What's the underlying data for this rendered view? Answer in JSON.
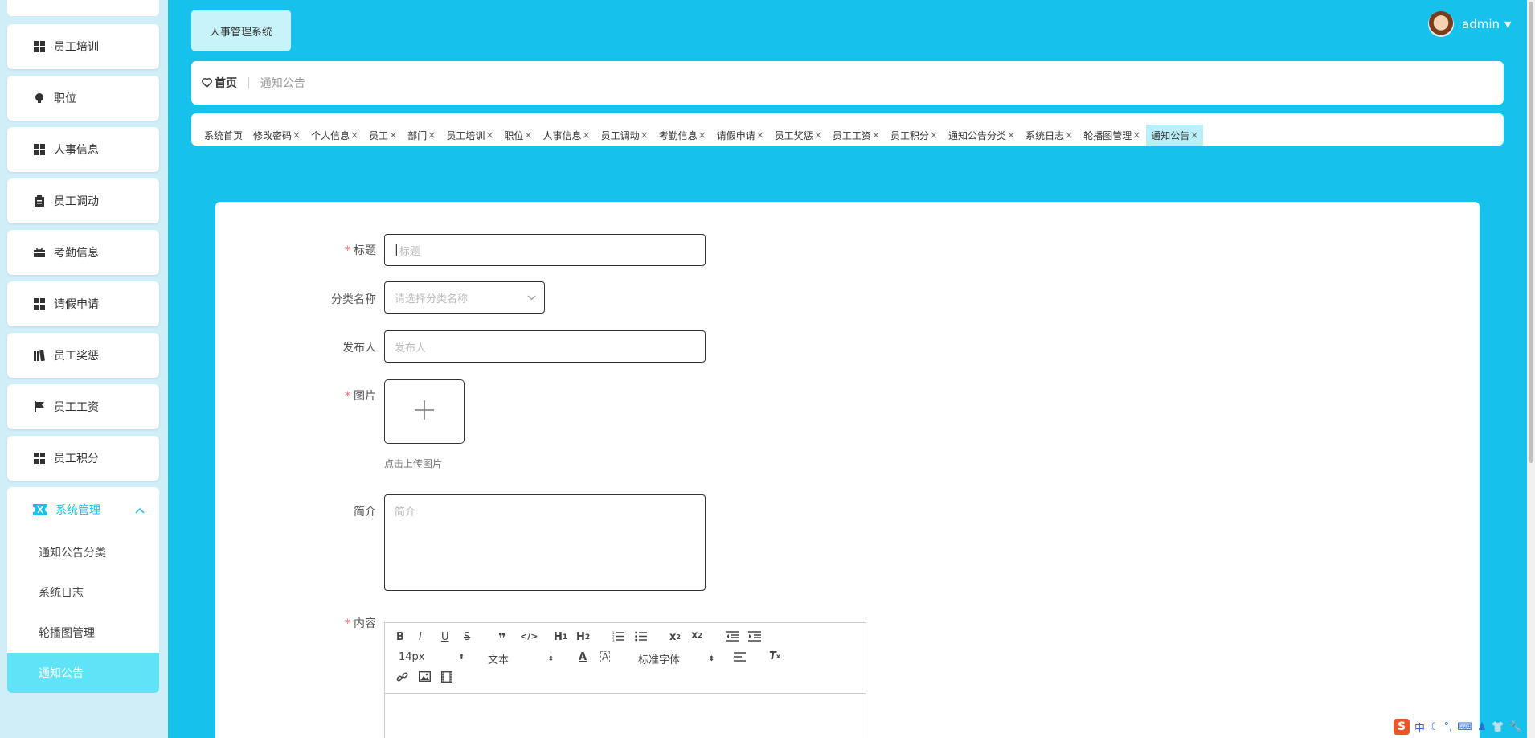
{
  "app": {
    "title": "人事管理系统"
  },
  "user": {
    "name": "admin"
  },
  "sidebar": {
    "items": [
      {
        "label": "员工培训",
        "icon": "grid-icon"
      },
      {
        "label": "职位",
        "icon": "bulb-icon"
      },
      {
        "label": "人事信息",
        "icon": "grid-icon"
      },
      {
        "label": "员工调动",
        "icon": "clipboard-icon"
      },
      {
        "label": "考勤信息",
        "icon": "briefcase-icon"
      },
      {
        "label": "请假申请",
        "icon": "grid-icon"
      },
      {
        "label": "员工奖惩",
        "icon": "book-icon"
      },
      {
        "label": "员工工资",
        "icon": "flag-icon"
      },
      {
        "label": "员工积分",
        "icon": "grid-icon"
      }
    ],
    "group": {
      "label": "系统管理",
      "icon": "ticket-icon",
      "sub": [
        {
          "label": "通知公告分类"
        },
        {
          "label": "系统日志"
        },
        {
          "label": "轮播图管理"
        },
        {
          "label": "通知公告"
        }
      ]
    }
  },
  "breadcrumb": {
    "home": "首页",
    "separator": "|",
    "current": "通知公告"
  },
  "tabs": [
    {
      "label": "系统首页",
      "closable": false
    },
    {
      "label": "修改密码",
      "closable": true
    },
    {
      "label": "个人信息",
      "closable": true
    },
    {
      "label": "员工",
      "closable": true
    },
    {
      "label": "部门",
      "closable": true
    },
    {
      "label": "员工培训",
      "closable": true
    },
    {
      "label": "职位",
      "closable": true
    },
    {
      "label": "人事信息",
      "closable": true
    },
    {
      "label": "员工调动",
      "closable": true
    },
    {
      "label": "考勤信息",
      "closable": true
    },
    {
      "label": "请假申请",
      "closable": true
    },
    {
      "label": "员工奖惩",
      "closable": true
    },
    {
      "label": "员工工资",
      "closable": true
    },
    {
      "label": "员工积分",
      "closable": true
    },
    {
      "label": "通知公告分类",
      "closable": true
    },
    {
      "label": "系统日志",
      "closable": true
    },
    {
      "label": "轮播图管理",
      "closable": true
    },
    {
      "label": "通知公告",
      "closable": true,
      "active": true
    }
  ],
  "form": {
    "title": {
      "label": "标题",
      "placeholder": "标题",
      "required": true
    },
    "category": {
      "label": "分类名称",
      "placeholder": "请选择分类名称"
    },
    "publisher": {
      "label": "发布人",
      "placeholder": "发布人"
    },
    "image": {
      "label": "图片",
      "tip": "点击上传图片",
      "required": true
    },
    "summary": {
      "label": "简介",
      "placeholder": "简介"
    },
    "content": {
      "label": "内容",
      "required": true
    }
  },
  "editor": {
    "size": "14px",
    "block": "文本",
    "font": "标准字体"
  },
  "ime": {
    "label": "中"
  },
  "colors": {
    "accent": "#16c1eb",
    "active_tab": "#b9eff9",
    "required": "#f56c6c"
  }
}
